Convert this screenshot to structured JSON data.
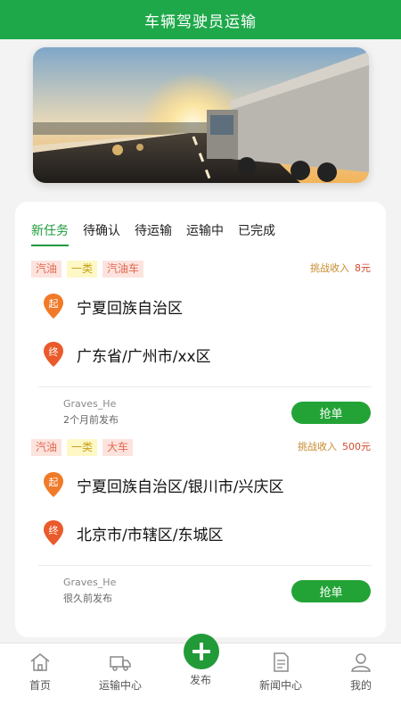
{
  "header": {
    "title": "车辆驾驶员运输"
  },
  "banner": {
    "image": "truck-sunset-road"
  },
  "tabs": [
    {
      "label": "新任务",
      "active": true
    },
    {
      "label": "待确认",
      "active": false
    },
    {
      "label": "待运输",
      "active": false
    },
    {
      "label": "运输中",
      "active": false
    },
    {
      "label": "已完成",
      "active": false
    }
  ],
  "tasks": [
    {
      "tags": [
        "汽油",
        "一类",
        "汽油车"
      ],
      "income_label": "挑战收入",
      "income_amount": "8元",
      "start_pin": "起",
      "start": "宁夏回族自治区",
      "end_pin": "终",
      "end": "广东省/广州市/xx区",
      "user": "Graves_He",
      "time": "2个月前发布",
      "button": "抢单"
    },
    {
      "tags": [
        "汽油",
        "一类",
        "大车"
      ],
      "income_label": "挑战收入",
      "income_amount": "500元",
      "start_pin": "起",
      "start": "宁夏回族自治区/银川市/兴庆区",
      "end_pin": "终",
      "end": "北京市/市辖区/东城区",
      "user": "Graves_He",
      "time": "很久前发布",
      "button": "抢单"
    }
  ],
  "tabbar": [
    {
      "label": "首页",
      "icon": "home-icon"
    },
    {
      "label": "运输中心",
      "icon": "truck-icon"
    },
    {
      "label": "发布",
      "icon": "plus-icon"
    },
    {
      "label": "新闻中心",
      "icon": "news-icon"
    },
    {
      "label": "我的",
      "icon": "profile-icon"
    }
  ],
  "colors": {
    "primary": "#1fa84a",
    "accent_orange": "#f07a28",
    "income_amount": "#d44a2a"
  }
}
